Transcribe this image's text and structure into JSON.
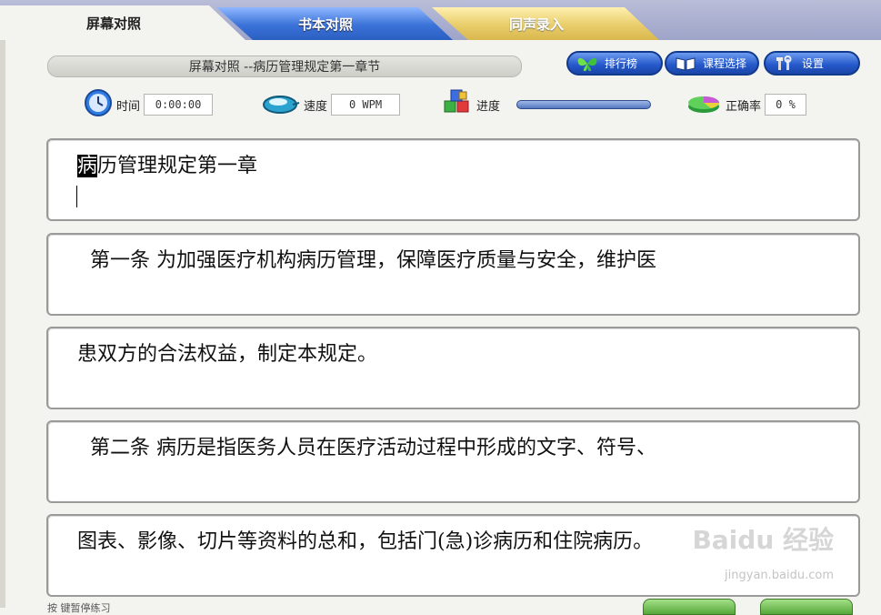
{
  "tabs": [
    {
      "label": "屏幕对照",
      "active": true
    },
    {
      "label": "书本对照",
      "active": false
    },
    {
      "label": "同声录入",
      "active": false
    }
  ],
  "title_bar": {
    "text": "屏幕对照 --病历管理规定第一章节"
  },
  "buttons": {
    "ranking": "排行榜",
    "course_select": "课程选择",
    "settings": "设置"
  },
  "stats": {
    "time_label": "时间",
    "time_value": "0:00:00",
    "speed_label": "速度",
    "speed_value": "0 WPM",
    "progress_label": "进度",
    "progress_fraction": 0,
    "accuracy_label": "正确率",
    "accuracy_value": "0 %"
  },
  "panels": [
    {
      "first_char": "病",
      "rest": "历管理规定第一章",
      "has_caret": true
    },
    {
      "text": "  第一条 为加强医疗机构病历管理，保障医疗质量与安全，维护医"
    },
    {
      "text": "患双方的合法权益，制定本规定。"
    },
    {
      "text": "  第二条 病历是指医务人员在医疗活动过程中形成的文字、符号、"
    },
    {
      "text": "图表、影像、切片等资料的总和，包括门(急)诊病历和住院病历。"
    }
  ],
  "bottom": {
    "partial_text": "按     键暂停练习"
  },
  "watermark": {
    "logo": "Baidu 经验",
    "url": "jingyan.baidu.com"
  },
  "colors": {
    "blue_button": "#2457c8",
    "tab_blue": "#3a72d8",
    "tab_gold": "#e9cd6a",
    "panel_border": "#9a9a98"
  }
}
